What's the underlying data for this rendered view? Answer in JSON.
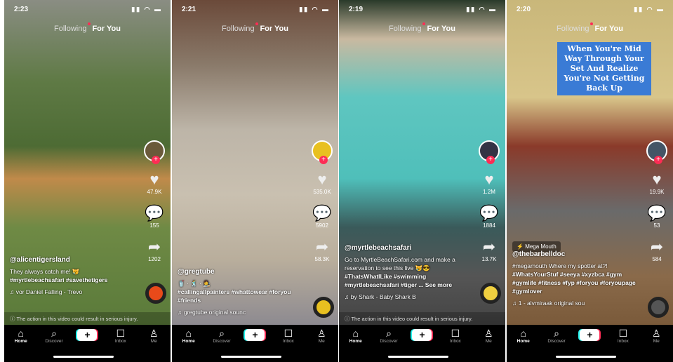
{
  "top_nav": {
    "following": "Following",
    "for_you": "For You"
  },
  "bottom_nav": {
    "home": "Home",
    "discover": "Discover",
    "create": "+",
    "inbox": "Inbox",
    "me": "Me"
  },
  "warning": "The action in this video could result in serious injury.",
  "colors": {
    "accent": "#fe2c55",
    "cyan": "#25f4ee",
    "nav_bg": "#000000"
  },
  "panels": [
    {
      "time": "2:23",
      "likes": "47.9K",
      "comments": "155",
      "shares": "1202",
      "user": "@alicentigersland",
      "caption": "They always catch me! 😿",
      "tags": "#myrtlebeachsafari #savethetigers",
      "music": "vor Daniel   Falling - Trevo",
      "warning": true
    },
    {
      "time": "2:21",
      "likes": "535.0K",
      "comments": "5902",
      "shares": "58.3K",
      "user": "@gregtube",
      "caption": "🥤 · 🕺 · 👩‍🎨",
      "tags": "#callingallpainters #whattowear #foryou #friends",
      "music": "gregtube   original sounc",
      "warning": false
    },
    {
      "time": "2:19",
      "likes": "1.2M",
      "comments": "1884",
      "shares": "13.7K",
      "user": "@myrtlebeachsafari",
      "caption": "Go to MyrtleBeachSafari.com and make a reservation to see this live 😿😎",
      "tags": "#ThatsWhatILike #swimming #myrtlebeachsafari #tiger ... See more",
      "music": "by Shark - Baby Shark   B",
      "warning": true
    },
    {
      "time": "2:20",
      "likes": "19.9K",
      "comments": "53",
      "shares": "584",
      "user": "@thebarbelldoc",
      "caption": "#megamouth Where my spotter at?!",
      "tags": "#WhatsYourStuf #seeya #xyzbca #gym #gymlife #fitness #fyp #foryou #foryoupage #gymlover",
      "music": "1 - alvmiraak   original sou",
      "warning": false,
      "badge": "Mega Mouth",
      "overlay": "When You're Mid Way Through Your Set And Realize You're Not Getting Back Up"
    }
  ]
}
